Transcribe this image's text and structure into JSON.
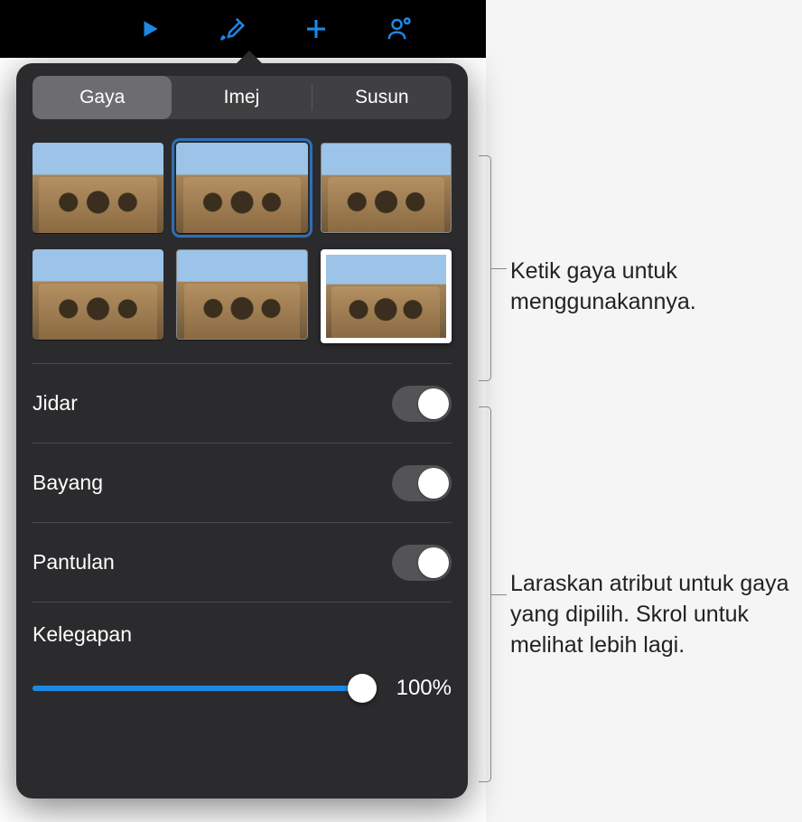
{
  "toolbar": {
    "icons": [
      "play-icon",
      "brush-icon",
      "plus-icon",
      "collaborate-icon"
    ]
  },
  "tabs": {
    "items": [
      {
        "label": "Gaya",
        "active": true
      },
      {
        "label": "Imej",
        "active": false
      },
      {
        "label": "Susun",
        "active": false
      }
    ]
  },
  "styles_grid": {
    "items": [
      {
        "variant": "plain",
        "selected": false
      },
      {
        "variant": "plain",
        "selected": true
      },
      {
        "variant": "thin-border",
        "selected": false
      },
      {
        "variant": "plain",
        "selected": false
      },
      {
        "variant": "thin-border",
        "selected": false
      },
      {
        "variant": "white-frame",
        "selected": false
      }
    ]
  },
  "controls": {
    "border": {
      "label": "Jidar",
      "on": false
    },
    "shadow": {
      "label": "Bayang",
      "on": false
    },
    "reflection": {
      "label": "Pantulan",
      "on": false
    },
    "opacity": {
      "label": "Kelegapan",
      "value_text": "100%",
      "value_pct": 100
    }
  },
  "annotations": {
    "styles": "Ketik gaya untuk menggunakannya.",
    "attrs": "Laraskan atribut untuk gaya yang dipilih. Skrol untuk melihat lebih lagi."
  },
  "colors": {
    "accent": "#1e88e5",
    "panel": "#2b2b2d"
  }
}
